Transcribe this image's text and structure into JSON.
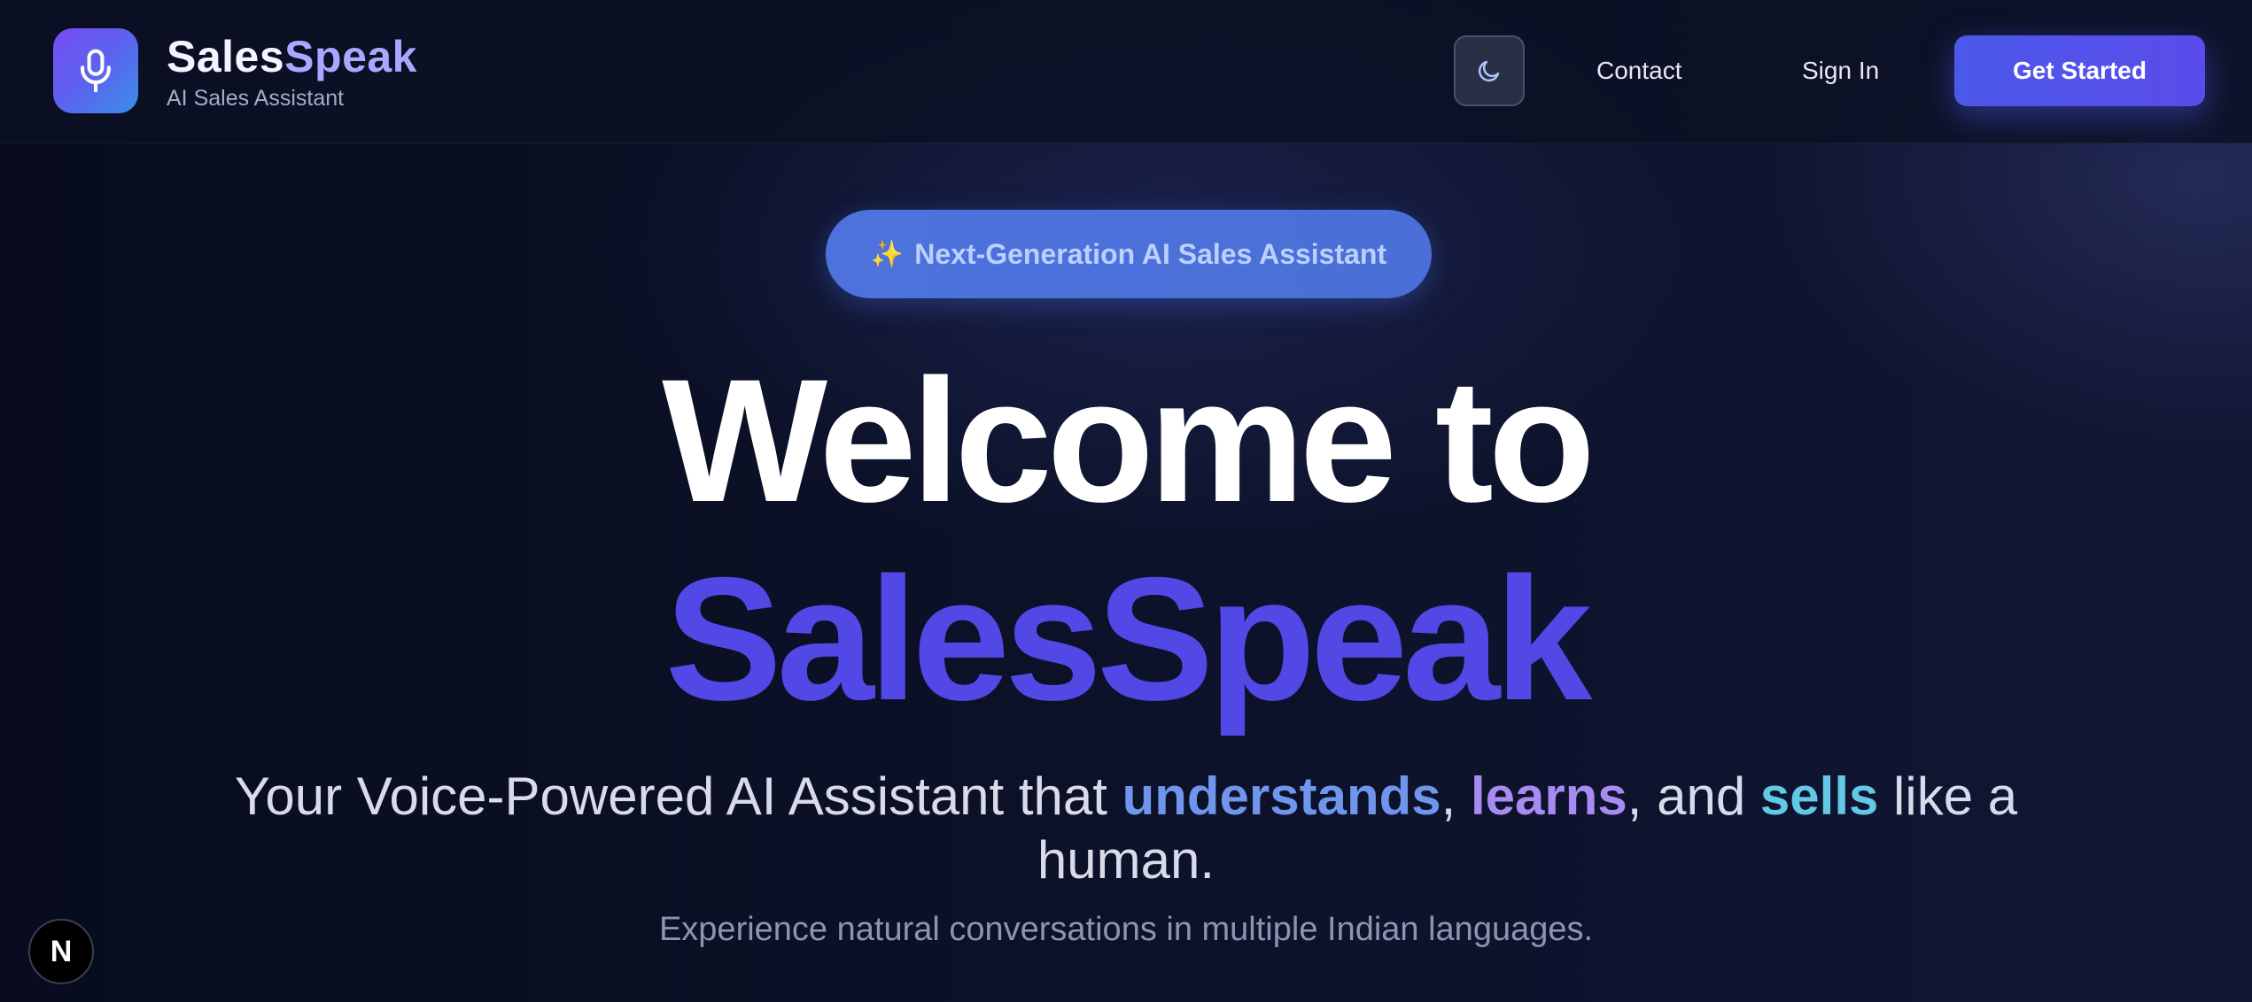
{
  "header": {
    "brand": {
      "name_part1": "Sales",
      "name_part2": "Speak",
      "tagline": "AI Sales Assistant",
      "logo_icon": "microphone-icon"
    },
    "theme_toggle_icon": "moon-icon",
    "nav": {
      "contact": "Contact",
      "sign_in": "Sign In"
    },
    "cta": "Get Started"
  },
  "hero": {
    "badge_emoji": "✨",
    "badge_text": "Next-Generation AI Sales Assistant",
    "title_line1": "Welcome to",
    "title_line2": "SalesSpeak",
    "tagline": {
      "prefix": "Your Voice-Powered AI Assistant that ",
      "word1": "understands",
      "sep1": ", ",
      "word2": "learns",
      "sep2": ", and ",
      "word3": "sells",
      "suffix": " like a human."
    },
    "subline": "Experience natural conversations in multiple Indian languages."
  },
  "dev_badge": {
    "letter": "N"
  },
  "colors": {
    "background": "#0c1024",
    "accent": "#5248e6",
    "highlight_understands": "#6f95ec",
    "highlight_learns": "#a78bf0",
    "highlight_sells": "#62c8e6"
  }
}
